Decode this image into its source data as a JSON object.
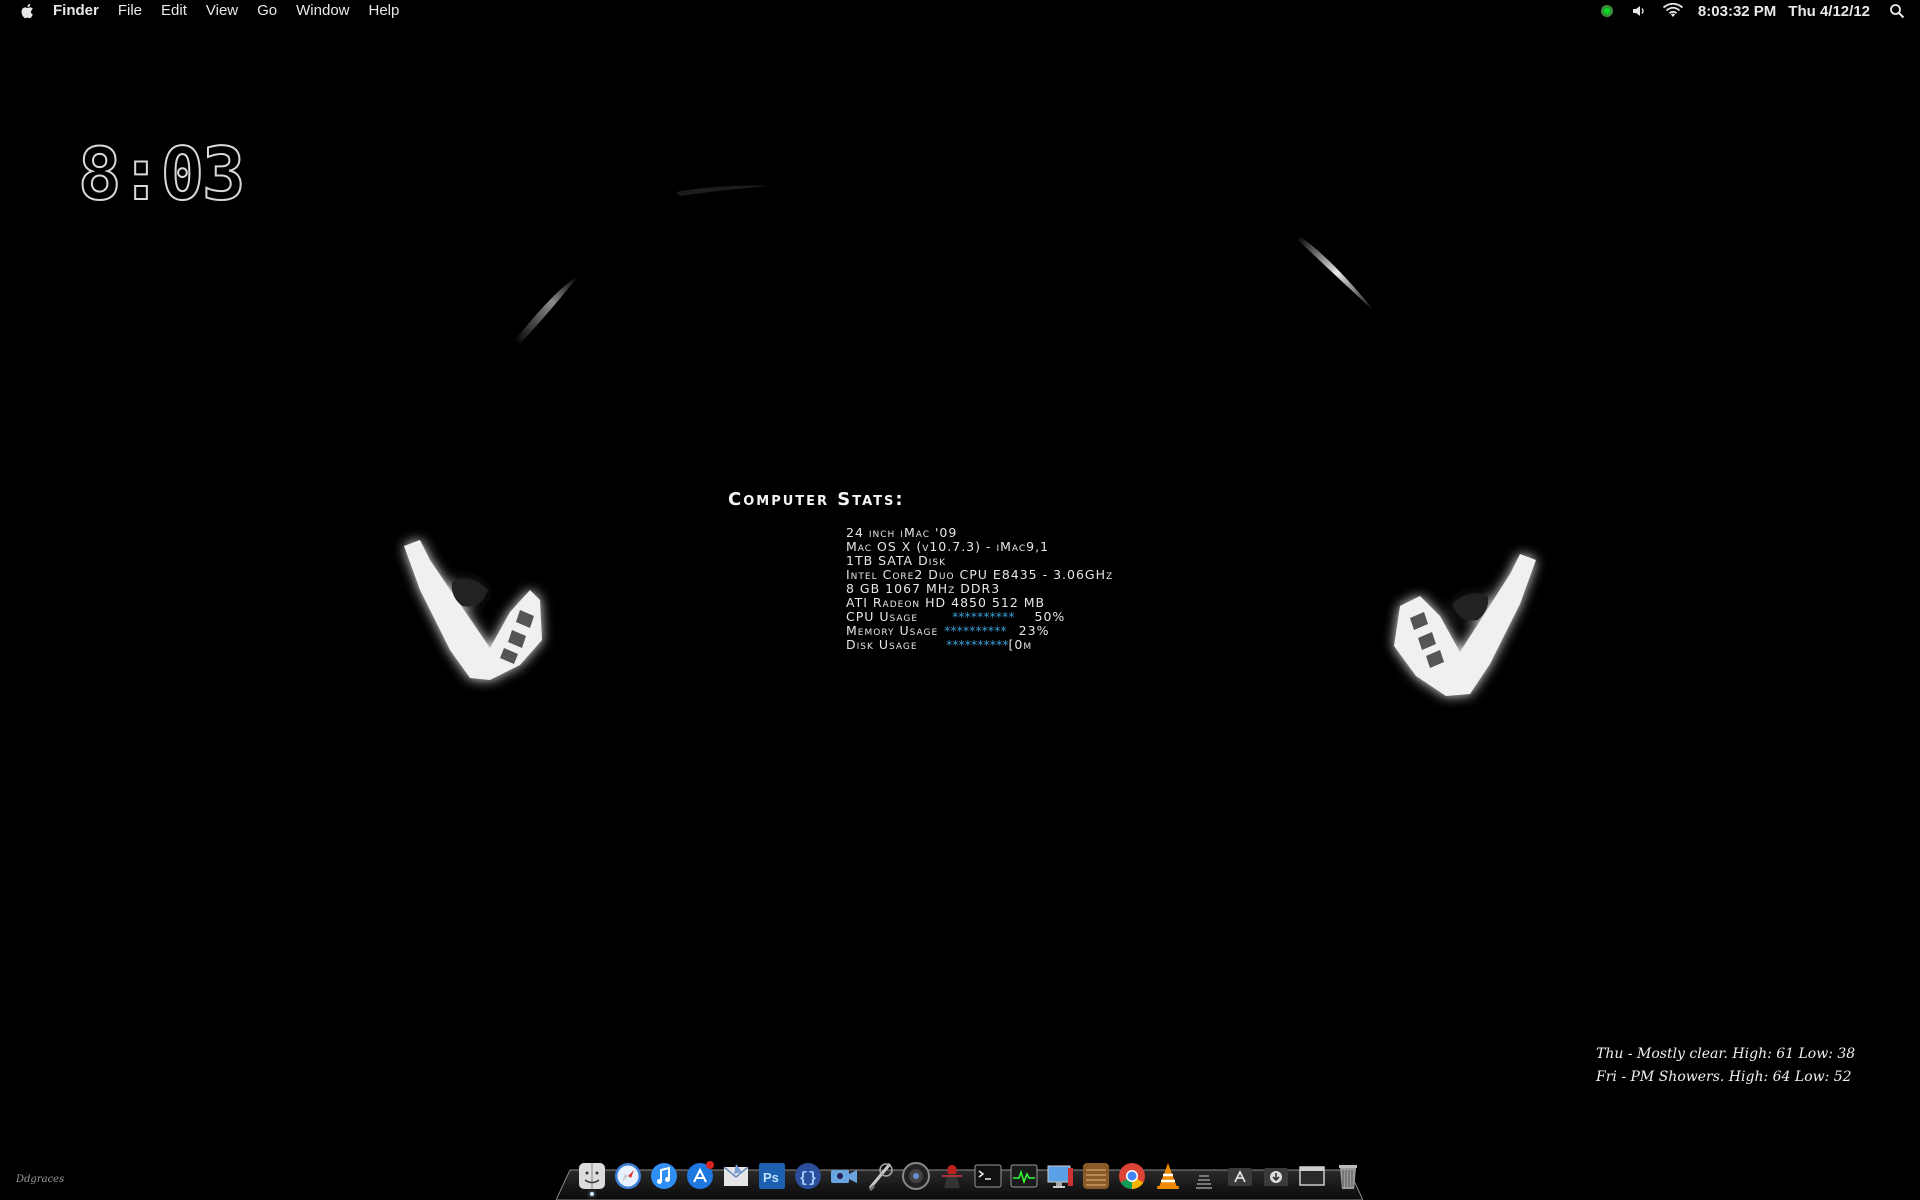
{
  "menubar": {
    "app_name": "Finder",
    "items": [
      "File",
      "Edit",
      "View",
      "Go",
      "Window",
      "Help"
    ],
    "clock": "8:03:32 PM",
    "date": "Thu 4/12/12",
    "status_icons": [
      "app-status-icon",
      "volume-icon",
      "wifi-icon",
      "spotlight-search-icon"
    ]
  },
  "clock_widget": {
    "time": "8:03"
  },
  "stats": {
    "title": "Computer Stats:",
    "lines": [
      "24 inch iMac '09",
      "Mac OS X (v10.7.3) - iMac9,1",
      "1TB SATA Disk",
      "Intel Core2 Duo CPU E8435 - 3.06GHz",
      "8 GB 1067 MHz DDR3",
      "ATI Radeon HD 4850 512 MB"
    ],
    "cpu": {
      "label": "CPU Usage",
      "bar": "**********",
      "value": "50%"
    },
    "memory": {
      "label": "Memory Usage",
      "bar": "**********",
      "value": "23%"
    },
    "disk": {
      "label": "Disk Usage",
      "bar": "**********",
      "value": "[0m"
    },
    "bar_color": "#3a9ed6"
  },
  "weather": {
    "line1": "Thu - Mostly clear. High: 61 Low: 38",
    "line2": "Fri - PM Showers. High: 64 Low: 52"
  },
  "signature": "Ddgraces",
  "dock": {
    "items": [
      "finder-icon",
      "safari-icon",
      "itunes-icon",
      "app-store-icon",
      "mail-icon",
      "photoshop-icon",
      "coda-icon",
      "facetime-icon",
      "script-editor-icon",
      "aperture-icon",
      "game-icon",
      "terminal-icon",
      "activity-monitor-icon",
      "system-info-icon",
      "app-icon",
      "notes-icon",
      "chrome-icon",
      "vlc-icon",
      "stack-icon",
      "applications-folder-icon",
      "downloads-folder-icon",
      "window-icon",
      "trash-icon"
    ]
  }
}
